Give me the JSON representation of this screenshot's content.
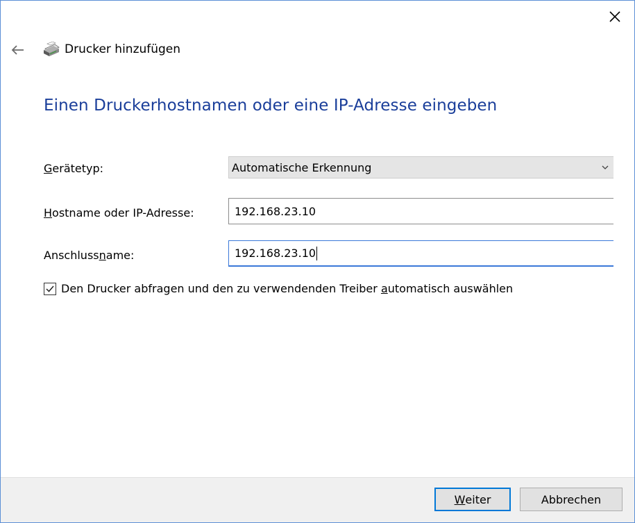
{
  "window": {
    "close_glyph": "✕"
  },
  "header": {
    "back_icon": "back-arrow-icon",
    "printer_icon": "printer-icon",
    "title": "Drucker hinzufügen"
  },
  "page": {
    "heading": "Einen Druckerhostnamen oder eine IP-Adresse eingeben"
  },
  "form": {
    "device_type": {
      "label_prefix": "",
      "label_underlined": "G",
      "label_suffix": "erätetyp:",
      "value": "Automatische Erkennung"
    },
    "hostname": {
      "label_prefix": "",
      "label_underlined": "H",
      "label_suffix": "ostname oder IP-Adresse:",
      "value": "192.168.23.10"
    },
    "port_name": {
      "label_prefix": "Anschluss",
      "label_underlined": "n",
      "label_suffix": "ame:",
      "value": "192.168.23.10"
    },
    "query_printer": {
      "checked": true,
      "label_prefix": "Den Drucker abfragen und den zu verwendenden Treiber ",
      "label_underlined": "a",
      "label_suffix": "utomatisch auswählen"
    }
  },
  "footer": {
    "next": {
      "label_underlined": "W",
      "label_suffix": "eiter"
    },
    "cancel": {
      "label": "Abbrechen"
    }
  }
}
